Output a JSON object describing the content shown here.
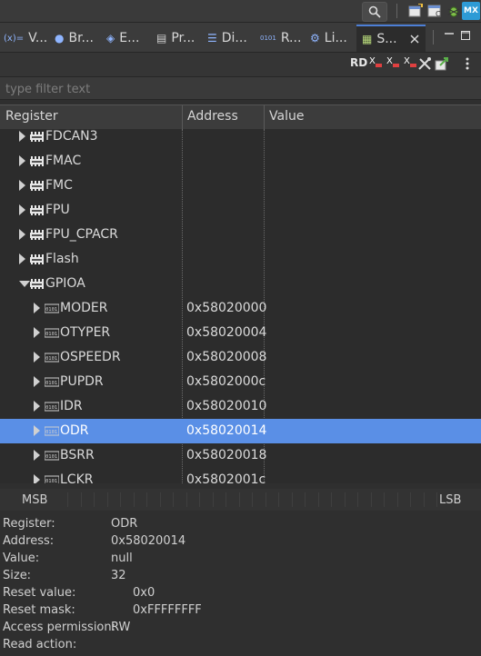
{
  "toolbar": {
    "badge_label": "MX"
  },
  "tabs": [
    {
      "icon": "(x)=",
      "label": "V..."
    },
    {
      "icon": "●",
      "label": "Br..."
    },
    {
      "icon": "◈",
      "label": "E..."
    },
    {
      "icon": "▤",
      "label": "Pr..."
    },
    {
      "icon": "☰",
      "label": "Di..."
    },
    {
      "icon": "0101",
      "label": "R..."
    },
    {
      "icon": "⚙",
      "label": "Li..."
    },
    {
      "icon": "▦",
      "label": "S..."
    }
  ],
  "view_toolbar": {
    "rd_label": "RD",
    "x_labels": [
      "X",
      "X",
      "X"
    ]
  },
  "filter": {
    "placeholder": "type filter text",
    "value": ""
  },
  "columns": {
    "register": "Register",
    "address": "Address",
    "value": "Value"
  },
  "tree": [
    {
      "level": 1,
      "kind": "peripheral",
      "label": "FDCAN3",
      "address": "",
      "expanded": false,
      "selected": false
    },
    {
      "level": 1,
      "kind": "peripheral",
      "label": "FMAC",
      "address": "",
      "expanded": false,
      "selected": false
    },
    {
      "level": 1,
      "kind": "peripheral",
      "label": "FMC",
      "address": "",
      "expanded": false,
      "selected": false
    },
    {
      "level": 1,
      "kind": "peripheral",
      "label": "FPU",
      "address": "",
      "expanded": false,
      "selected": false
    },
    {
      "level": 1,
      "kind": "peripheral",
      "label": "FPU_CPACR",
      "address": "",
      "expanded": false,
      "selected": false
    },
    {
      "level": 1,
      "kind": "peripheral",
      "label": "Flash",
      "address": "",
      "expanded": false,
      "selected": false
    },
    {
      "level": 1,
      "kind": "peripheral",
      "label": "GPIOA",
      "address": "",
      "expanded": true,
      "selected": false
    },
    {
      "level": 2,
      "kind": "register",
      "label": "MODER",
      "address": "0x58020000",
      "expanded": false,
      "selected": false
    },
    {
      "level": 2,
      "kind": "register",
      "label": "OTYPER",
      "address": "0x58020004",
      "expanded": false,
      "selected": false
    },
    {
      "level": 2,
      "kind": "register",
      "label": "OSPEEDR",
      "address": "0x58020008",
      "expanded": false,
      "selected": false
    },
    {
      "level": 2,
      "kind": "register",
      "label": "PUPDR",
      "address": "0x5802000c",
      "expanded": false,
      "selected": false
    },
    {
      "level": 2,
      "kind": "register",
      "label": "IDR",
      "address": "0x58020010",
      "expanded": false,
      "selected": false
    },
    {
      "level": 2,
      "kind": "register",
      "label": "ODR",
      "address": "0x58020014",
      "expanded": false,
      "selected": true
    },
    {
      "level": 2,
      "kind": "register",
      "label": "BSRR",
      "address": "0x58020018",
      "expanded": false,
      "selected": false
    },
    {
      "level": 2,
      "kind": "register",
      "label": "LCKR",
      "address": "0x5802001c",
      "expanded": false,
      "selected": false
    }
  ],
  "bitbar": {
    "msb": "MSB",
    "lsb": "LSB"
  },
  "details": {
    "register_label": "Register:",
    "register_value": "ODR",
    "address_label": "Address:",
    "address_value": "0x58020014",
    "value_label": "Value:",
    "value_value": "null",
    "size_label": "Size:",
    "size_value": "32",
    "reset_value_label": "Reset value:",
    "reset_value_value": "0x0",
    "reset_mask_label": "Reset mask:",
    "reset_mask_value": "0xFFFFFFFF",
    "access_label": "Access permission:",
    "access_value": "RW",
    "read_action_label": "Read action:",
    "read_action_value": ""
  },
  "colors": {
    "selection": "#5a8fe6",
    "active_tab_accent": "#4d7fd6",
    "background": "#2c2c2c"
  }
}
